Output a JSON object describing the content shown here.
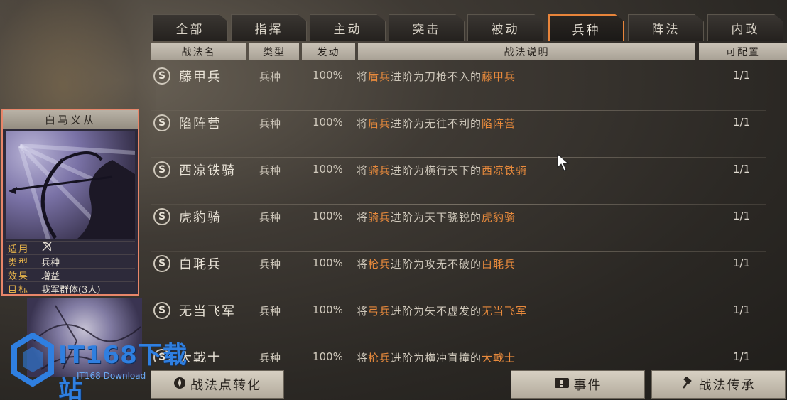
{
  "tabs": [
    {
      "label": "全部",
      "active": false
    },
    {
      "label": "指挥",
      "active": false
    },
    {
      "label": "主动",
      "active": false
    },
    {
      "label": "突击",
      "active": false
    },
    {
      "label": "被动",
      "active": false
    },
    {
      "label": "兵种",
      "active": true
    },
    {
      "label": "阵法",
      "active": false
    },
    {
      "label": "内政",
      "active": false
    }
  ],
  "columns": {
    "name": "战法名",
    "type": "类型",
    "rate": "发动",
    "desc": "战法说明",
    "slots": "可配置"
  },
  "rows": [
    {
      "grade": "S",
      "name": "藤甲兵",
      "type": "兵种",
      "rate": "100%",
      "desc_pre": "将",
      "desc_unit": "盾兵",
      "desc_mid": "进阶为刀枪不入的",
      "desc_target": "藤甲兵",
      "slots": "1/1"
    },
    {
      "grade": "S",
      "name": "陷阵营",
      "type": "兵种",
      "rate": "100%",
      "desc_pre": "将",
      "desc_unit": "盾兵",
      "desc_mid": "进阶为无往不利的",
      "desc_target": "陷阵营",
      "slots": "1/1"
    },
    {
      "grade": "S",
      "name": "西凉铁骑",
      "type": "兵种",
      "rate": "100%",
      "desc_pre": "将",
      "desc_unit": "骑兵",
      "desc_mid": "进阶为横行天下的",
      "desc_target": "西凉铁骑",
      "slots": "1/1"
    },
    {
      "grade": "S",
      "name": "虎豹骑",
      "type": "兵种",
      "rate": "100%",
      "desc_pre": "将",
      "desc_unit": "骑兵",
      "desc_mid": "进阶为天下骁锐的",
      "desc_target": "虎豹骑",
      "slots": "1/1"
    },
    {
      "grade": "S",
      "name": "白毦兵",
      "type": "兵种",
      "rate": "100%",
      "desc_pre": "将",
      "desc_unit": "枪兵",
      "desc_mid": "进阶为攻无不破的",
      "desc_target": "白毦兵",
      "slots": "1/1"
    },
    {
      "grade": "S",
      "name": "无当飞军",
      "type": "兵种",
      "rate": "100%",
      "desc_pre": "将",
      "desc_unit": "弓兵",
      "desc_mid": "进阶为矢不虚发的",
      "desc_target": "无当飞军",
      "slots": "1/1"
    },
    {
      "grade": "S",
      "name": "大戟士",
      "type": "兵种",
      "rate": "100%",
      "desc_pre": "将",
      "desc_unit": "枪兵",
      "desc_mid": "进阶为横冲直撞的",
      "desc_target": "大戟士",
      "slots": "1/1"
    }
  ],
  "card": {
    "title": "白马义从",
    "info": [
      {
        "key": "适用",
        "value": ""
      },
      {
        "key": "类型",
        "value": "兵种"
      },
      {
        "key": "效果",
        "value": "增益"
      },
      {
        "key": "目标",
        "value": "我军群体(3人)"
      }
    ]
  },
  "buttons": {
    "convert": "战法点转化",
    "events": "事件",
    "inherit": "战法传承"
  },
  "watermark": {
    "text": "IT168下载站",
    "sub": "IT168 Download"
  },
  "colors": {
    "accent": "#e8843a",
    "highlight": "#e88a3c",
    "card_border": "#e8866a"
  }
}
